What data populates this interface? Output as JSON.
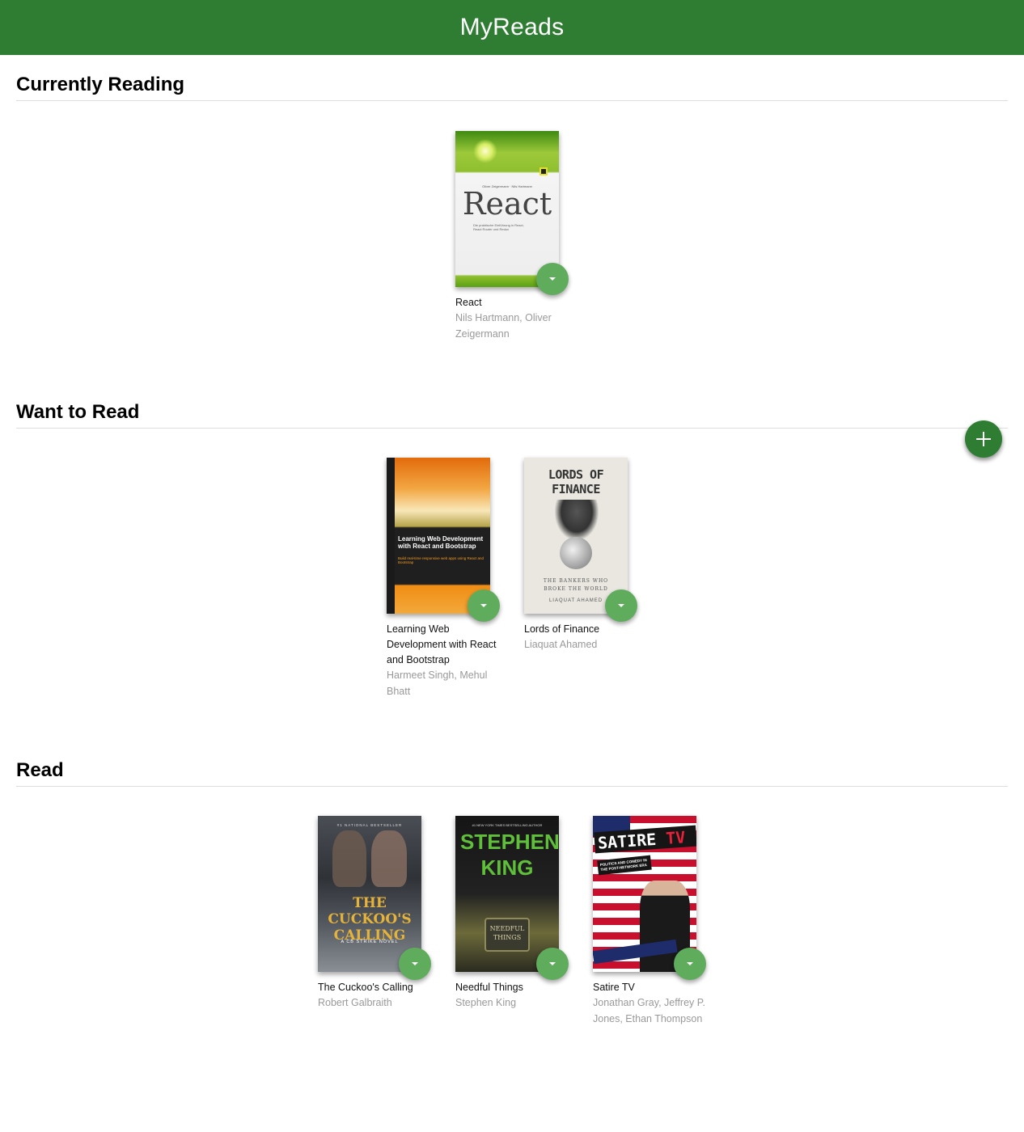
{
  "app": {
    "title": "MyReads"
  },
  "shelves": [
    {
      "title": "Currently Reading",
      "books": [
        {
          "title": "React",
          "authors": "Nils Hartmann, Oliver Zeigermann",
          "cover": {
            "top_text": "Oliver Zeigermann · Nils Hartmann",
            "main_text": "React",
            "sub_text": "Die praktische Einführung in React, React Router und Redux",
            "colors": [
              "#5aa114",
              "#c7df4a",
              "#f2f2f2"
            ]
          }
        }
      ]
    },
    {
      "title": "Want to Read",
      "books": [
        {
          "title": "Learning Web Development with React and Bootstrap",
          "authors": "Harmeet Singh, Mehul Bhatt",
          "cover": {
            "main_text": "Learning Web Development with React and Bootstrap",
            "sub_text": "Build real-time responsive web apps using React and Bootstrap",
            "colors": [
              "#e07a12",
              "#222222",
              "#f39a1e"
            ]
          }
        },
        {
          "title": "Lords of Finance",
          "authors": "Liaquat Ahamed",
          "cover": {
            "main_text": "LORDS OF FINANCE",
            "sub_text": "THE BANKERS WHO BROKE THE WORLD",
            "author_text": "LIAQUAT AHAMED",
            "colors": [
              "#e8e6df",
              "#3a3a3a"
            ]
          }
        }
      ]
    },
    {
      "title": "Read",
      "books": [
        {
          "title": "The Cuckoo's Calling",
          "authors": "Robert Galbraith",
          "cover": {
            "top_text": "#1 NATIONAL BESTSELLER",
            "main_text": "THE CUCKOO'S CALLING",
            "sub_text": "A CB STRIKE NOVEL",
            "colors": [
              "#3b3f45",
              "#e6b33a"
            ]
          }
        },
        {
          "title": "Needful Things",
          "authors": "Stephen King",
          "cover": {
            "top_text": "#1 NEW YORK TIMES BESTSELLING AUTHOR",
            "main_text": "STEPHEN KING",
            "sub_text": "NEEDFUL THINGS",
            "colors": [
              "#1a1a1a",
              "#5fbf3a"
            ]
          }
        },
        {
          "title": "Satire TV",
          "authors": "Jonathan Gray, Jeffrey P. Jones, Ethan Thompson",
          "cover": {
            "main_text": "SATIRE",
            "main_accent": "TV",
            "sub_text": "POLITICS AND COMEDY IN THE POST-NETWORK ERA",
            "colors": [
              "#c8102e",
              "#ffffff",
              "#1f2c6b"
            ]
          }
        }
      ]
    }
  ],
  "actions": {
    "add_book_icon": "plus-icon",
    "shelf_changer_icon": "chevron-down-icon",
    "accent": "#2e7d32",
    "changer_color": "#60ac5d"
  }
}
